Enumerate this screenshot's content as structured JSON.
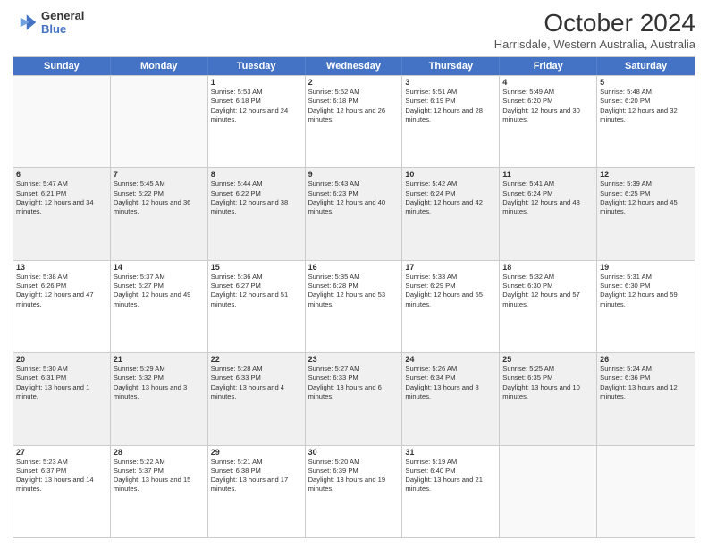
{
  "logo": {
    "line1": "General",
    "line2": "Blue"
  },
  "title": "October 2024",
  "subtitle": "Harrisdale, Western Australia, Australia",
  "headers": [
    "Sunday",
    "Monday",
    "Tuesday",
    "Wednesday",
    "Thursday",
    "Friday",
    "Saturday"
  ],
  "weeks": [
    [
      {
        "day": "",
        "info": "",
        "empty": true
      },
      {
        "day": "",
        "info": "",
        "empty": true
      },
      {
        "day": "1",
        "info": "Sunrise: 5:53 AM\nSunset: 6:18 PM\nDaylight: 12 hours and 24 minutes."
      },
      {
        "day": "2",
        "info": "Sunrise: 5:52 AM\nSunset: 6:18 PM\nDaylight: 12 hours and 26 minutes."
      },
      {
        "day": "3",
        "info": "Sunrise: 5:51 AM\nSunset: 6:19 PM\nDaylight: 12 hours and 28 minutes."
      },
      {
        "day": "4",
        "info": "Sunrise: 5:49 AM\nSunset: 6:20 PM\nDaylight: 12 hours and 30 minutes."
      },
      {
        "day": "5",
        "info": "Sunrise: 5:48 AM\nSunset: 6:20 PM\nDaylight: 12 hours and 32 minutes."
      }
    ],
    [
      {
        "day": "6",
        "info": "Sunrise: 5:47 AM\nSunset: 6:21 PM\nDaylight: 12 hours and 34 minutes."
      },
      {
        "day": "7",
        "info": "Sunrise: 5:45 AM\nSunset: 6:22 PM\nDaylight: 12 hours and 36 minutes."
      },
      {
        "day": "8",
        "info": "Sunrise: 5:44 AM\nSunset: 6:22 PM\nDaylight: 12 hours and 38 minutes."
      },
      {
        "day": "9",
        "info": "Sunrise: 5:43 AM\nSunset: 6:23 PM\nDaylight: 12 hours and 40 minutes."
      },
      {
        "day": "10",
        "info": "Sunrise: 5:42 AM\nSunset: 6:24 PM\nDaylight: 12 hours and 42 minutes."
      },
      {
        "day": "11",
        "info": "Sunrise: 5:41 AM\nSunset: 6:24 PM\nDaylight: 12 hours and 43 minutes."
      },
      {
        "day": "12",
        "info": "Sunrise: 5:39 AM\nSunset: 6:25 PM\nDaylight: 12 hours and 45 minutes."
      }
    ],
    [
      {
        "day": "13",
        "info": "Sunrise: 5:38 AM\nSunset: 6:26 PM\nDaylight: 12 hours and 47 minutes."
      },
      {
        "day": "14",
        "info": "Sunrise: 5:37 AM\nSunset: 6:27 PM\nDaylight: 12 hours and 49 minutes."
      },
      {
        "day": "15",
        "info": "Sunrise: 5:36 AM\nSunset: 6:27 PM\nDaylight: 12 hours and 51 minutes."
      },
      {
        "day": "16",
        "info": "Sunrise: 5:35 AM\nSunset: 6:28 PM\nDaylight: 12 hours and 53 minutes."
      },
      {
        "day": "17",
        "info": "Sunrise: 5:33 AM\nSunset: 6:29 PM\nDaylight: 12 hours and 55 minutes."
      },
      {
        "day": "18",
        "info": "Sunrise: 5:32 AM\nSunset: 6:30 PM\nDaylight: 12 hours and 57 minutes."
      },
      {
        "day": "19",
        "info": "Sunrise: 5:31 AM\nSunset: 6:30 PM\nDaylight: 12 hours and 59 minutes."
      }
    ],
    [
      {
        "day": "20",
        "info": "Sunrise: 5:30 AM\nSunset: 6:31 PM\nDaylight: 13 hours and 1 minute."
      },
      {
        "day": "21",
        "info": "Sunrise: 5:29 AM\nSunset: 6:32 PM\nDaylight: 13 hours and 3 minutes."
      },
      {
        "day": "22",
        "info": "Sunrise: 5:28 AM\nSunset: 6:33 PM\nDaylight: 13 hours and 4 minutes."
      },
      {
        "day": "23",
        "info": "Sunrise: 5:27 AM\nSunset: 6:33 PM\nDaylight: 13 hours and 6 minutes."
      },
      {
        "day": "24",
        "info": "Sunrise: 5:26 AM\nSunset: 6:34 PM\nDaylight: 13 hours and 8 minutes."
      },
      {
        "day": "25",
        "info": "Sunrise: 5:25 AM\nSunset: 6:35 PM\nDaylight: 13 hours and 10 minutes."
      },
      {
        "day": "26",
        "info": "Sunrise: 5:24 AM\nSunset: 6:36 PM\nDaylight: 13 hours and 12 minutes."
      }
    ],
    [
      {
        "day": "27",
        "info": "Sunrise: 5:23 AM\nSunset: 6:37 PM\nDaylight: 13 hours and 14 minutes."
      },
      {
        "day": "28",
        "info": "Sunrise: 5:22 AM\nSunset: 6:37 PM\nDaylight: 13 hours and 15 minutes."
      },
      {
        "day": "29",
        "info": "Sunrise: 5:21 AM\nSunset: 6:38 PM\nDaylight: 13 hours and 17 minutes."
      },
      {
        "day": "30",
        "info": "Sunrise: 5:20 AM\nSunset: 6:39 PM\nDaylight: 13 hours and 19 minutes."
      },
      {
        "day": "31",
        "info": "Sunrise: 5:19 AM\nSunset: 6:40 PM\nDaylight: 13 hours and 21 minutes."
      },
      {
        "day": "",
        "info": "",
        "empty": true
      },
      {
        "day": "",
        "info": "",
        "empty": true
      }
    ]
  ]
}
